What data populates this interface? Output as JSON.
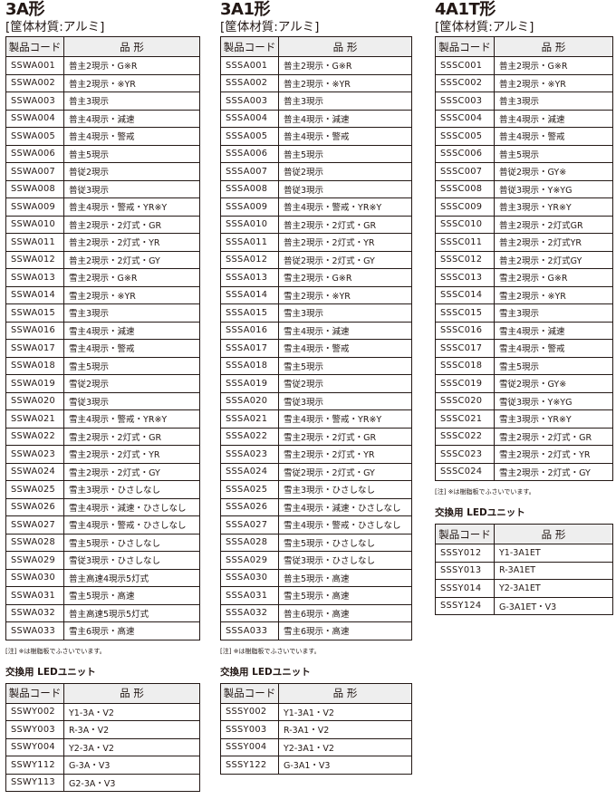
{
  "sections": [
    {
      "title": "3A形",
      "subtitle": "[筐体材質:アルミ]",
      "headers": [
        "製品コード",
        "品 形"
      ],
      "rows": [
        [
          "SSWA001",
          "普主2現示・G※R"
        ],
        [
          "SSWA002",
          "普主2現示・※YR"
        ],
        [
          "SSWA003",
          "普主3現示"
        ],
        [
          "SSWA004",
          "普主4現示・減速"
        ],
        [
          "SSWA005",
          "普主4現示・警戒"
        ],
        [
          "SSWA006",
          "普主5現示"
        ],
        [
          "SSWA007",
          "普従2現示"
        ],
        [
          "SSWA008",
          "普従3現示"
        ],
        [
          "SSWA009",
          "普主4現示・警戒・YR※Y"
        ],
        [
          "SSWA010",
          "普主2現示・2灯式・GR"
        ],
        [
          "SSWA011",
          "普主2現示・2灯式・YR"
        ],
        [
          "SSWA012",
          "普主2現示・2灯式・GY"
        ],
        [
          "SSWA013",
          "雪主2現示・G※R"
        ],
        [
          "SSWA014",
          "雪主2現示・※YR"
        ],
        [
          "SSWA015",
          "雪主3現示"
        ],
        [
          "SSWA016",
          "雪主4現示・減速"
        ],
        [
          "SSWA017",
          "雪主4現示・警戒"
        ],
        [
          "SSWA018",
          "雪主5現示"
        ],
        [
          "SSWA019",
          "雪従2現示"
        ],
        [
          "SSWA020",
          "雪従3現示"
        ],
        [
          "SSWA021",
          "雪主4現示・警戒・YR※Y"
        ],
        [
          "SSWA022",
          "雪主2現示・2灯式・GR"
        ],
        [
          "SSWA023",
          "雪主2現示・2灯式・YR"
        ],
        [
          "SSWA024",
          "雪主2現示・2灯式・GY"
        ],
        [
          "SSWA025",
          "雪主3現示・ひさしなし"
        ],
        [
          "SSWA026",
          "雪主4現示・減速・ひさしなし"
        ],
        [
          "SSWA027",
          "雪主4現示・警戒・ひさしなし"
        ],
        [
          "SSWA028",
          "雪主5現示・ひさしなし"
        ],
        [
          "SSWA029",
          "雪従3現示・ひさしなし"
        ],
        [
          "SSWA030",
          "普主高速4現示5灯式"
        ],
        [
          "SSWA031",
          "雪主5現示・高速"
        ],
        [
          "SSWA032",
          "普主高速5現示5灯式"
        ],
        [
          "SSWA033",
          "雪主6現示・高速"
        ]
      ],
      "note": "[注] ※は樹脂板でふさいでいます。",
      "led_title": "交換用 LEDユニット",
      "led_headers": [
        "製品コード",
        "品 形"
      ],
      "led_rows": [
        [
          "SSWY002",
          "Y1-3A・V2"
        ],
        [
          "SSWY003",
          "R-3A・V2"
        ],
        [
          "SSWY004",
          "Y2-3A・V2"
        ],
        [
          "SSWY112",
          "G-3A・V3"
        ],
        [
          "SSWY113",
          "G2-3A・V3"
        ]
      ]
    },
    {
      "title": "3A1形",
      "subtitle": "[筐体材質:アルミ]",
      "headers": [
        "製品コード",
        "品 形"
      ],
      "rows": [
        [
          "SSSA001",
          "普主2現示・G※R"
        ],
        [
          "SSSA002",
          "普主2現示・※YR"
        ],
        [
          "SSSA003",
          "普主3現示"
        ],
        [
          "SSSA004",
          "普主4現示・減速"
        ],
        [
          "SSSA005",
          "普主4現示・警戒"
        ],
        [
          "SSSA006",
          "普主5現示"
        ],
        [
          "SSSA007",
          "普従2現示"
        ],
        [
          "SSSA008",
          "普従3現示"
        ],
        [
          "SSSA009",
          "普主4現示・警戒・YR※Y"
        ],
        [
          "SSSA010",
          "普主2現示・2灯式・GR"
        ],
        [
          "SSSA011",
          "普主2現示・2灯式・YR"
        ],
        [
          "SSSA012",
          "普従2現示・2灯式・GY"
        ],
        [
          "SSSA013",
          "雪主2現示・G※R"
        ],
        [
          "SSSA014",
          "雪主2現示・※YR"
        ],
        [
          "SSSA015",
          "雪主3現示"
        ],
        [
          "SSSA016",
          "雪主4現示・減速"
        ],
        [
          "SSSA017",
          "雪主4現示・警戒"
        ],
        [
          "SSSA018",
          "雪主5現示"
        ],
        [
          "SSSA019",
          "雪従2現示"
        ],
        [
          "SSSA020",
          "雪従3現示"
        ],
        [
          "SSSA021",
          "雪主4現示・警戒・YR※Y"
        ],
        [
          "SSSA022",
          "雪主2現示・2灯式・GR"
        ],
        [
          "SSSA023",
          "雪主2現示・2灯式・YR"
        ],
        [
          "SSSA024",
          "雪従2現示・2灯式・GY"
        ],
        [
          "SSSA025",
          "雪主3現示・ひさしなし"
        ],
        [
          "SSSA026",
          "雪主4現示・減速・ひさしなし"
        ],
        [
          "SSSA027",
          "雪主4現示・警戒・ひさしなし"
        ],
        [
          "SSSA028",
          "雪主5現示・ひさしなし"
        ],
        [
          "SSSA029",
          "雪従3現示・ひさしなし"
        ],
        [
          "SSSA030",
          "普主5現示・高速"
        ],
        [
          "SSSA031",
          "雪主5現示・高速"
        ],
        [
          "SSSA032",
          "普主6現示・高速"
        ],
        [
          "SSSA033",
          "雪主6現示・高速"
        ]
      ],
      "note": "[注] ※は樹脂板でふさいでいます。",
      "led_title": "交換用 LEDユニット",
      "led_headers": [
        "製品コード",
        "品 形"
      ],
      "led_rows": [
        [
          "SSSY002",
          "Y1-3A1・V2"
        ],
        [
          "SSSY003",
          "R-3A1・V2"
        ],
        [
          "SSSY004",
          "Y2-3A1・V2"
        ],
        [
          "SSSY122",
          "G-3A1・V3"
        ]
      ]
    },
    {
      "title": "4A1T形",
      "subtitle": "[筐体材質:アルミ]",
      "headers": [
        "製品コード",
        "品 形"
      ],
      "rows": [
        [
          "SSSC001",
          "普主2現示・G※R"
        ],
        [
          "SSSC002",
          "普主2現示・※YR"
        ],
        [
          "SSSC003",
          "普主3現示"
        ],
        [
          "SSSC004",
          "普主4現示・減速"
        ],
        [
          "SSSC005",
          "普主4現示・警戒"
        ],
        [
          "SSSC006",
          "普主5現示"
        ],
        [
          "SSSC007",
          "普従2現示・GY※"
        ],
        [
          "SSSC008",
          "普従3現示・Y※YG"
        ],
        [
          "SSSC009",
          "普主3現示・YR※Y"
        ],
        [
          "SSSC010",
          "普主2現示・2灯式GR"
        ],
        [
          "SSSC011",
          "普主2現示・2灯式YR"
        ],
        [
          "SSSC012",
          "普主2現示・2灯式GY"
        ],
        [
          "SSSC013",
          "雪主2現示・G※R"
        ],
        [
          "SSSC014",
          "雪主2現示・※YR"
        ],
        [
          "SSSC015",
          "雪主3現示"
        ],
        [
          "SSSC016",
          "雪主4現示・減速"
        ],
        [
          "SSSC017",
          "雪主4現示・警戒"
        ],
        [
          "SSSC018",
          "雪主5現示"
        ],
        [
          "SSSC019",
          "雪従2現示・GY※"
        ],
        [
          "SSSC020",
          "雪従3現示・Y※YG"
        ],
        [
          "SSSC021",
          "雪主3現示・YR※Y"
        ],
        [
          "SSSC022",
          "雪主2現示・2灯式・GR"
        ],
        [
          "SSSC023",
          "雪主2現示・2灯式・YR"
        ],
        [
          "SSSC024",
          "雪主2現示・2灯式・GY"
        ]
      ],
      "note": "[注] ※は樹脂板でふさいでいます。",
      "led_title": "交換用 LEDユニット",
      "led_headers": [
        "製品コード",
        "品 形"
      ],
      "led_rows": [
        [
          "SSSY012",
          "Y1-3A1ET"
        ],
        [
          "SSSY013",
          "R-3A1ET"
        ],
        [
          "SSSY014",
          "Y2-3A1ET"
        ],
        [
          "SSSY124",
          "G-3A1ET・V3"
        ]
      ]
    }
  ],
  "colors": {
    "text": "#231815",
    "header_bg": "#eeeeee",
    "border": "#231815"
  }
}
